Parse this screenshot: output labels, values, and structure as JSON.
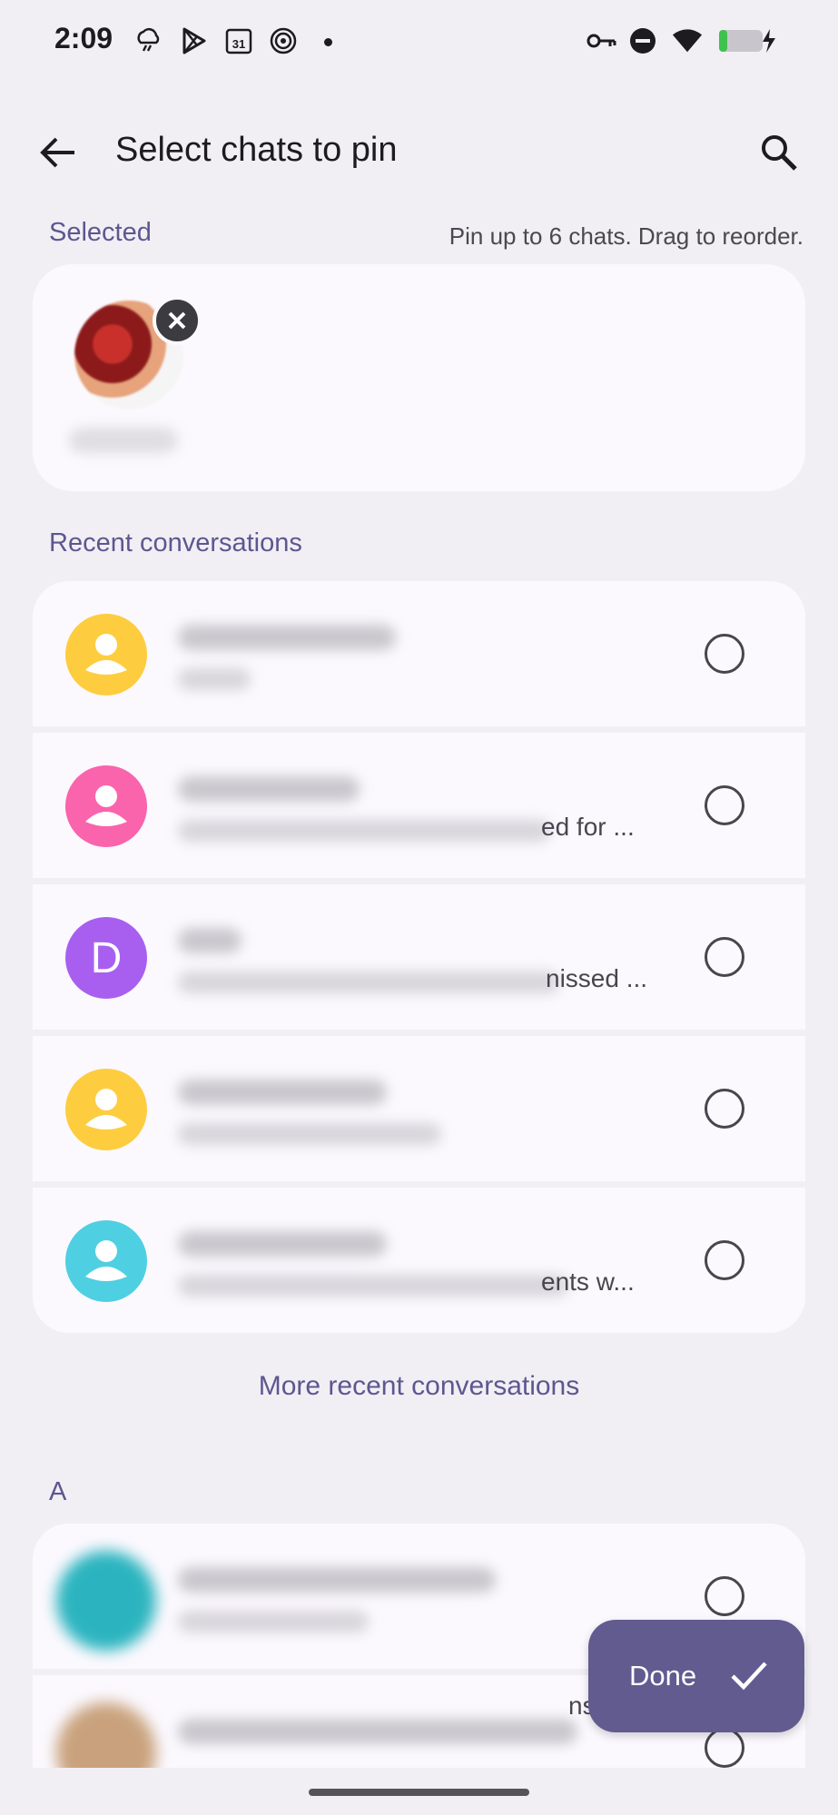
{
  "status_bar": {
    "time": "2:09",
    "left_icons": [
      "weather-icon",
      "play-store-icon",
      "calendar-icon",
      "spiral-icon"
    ],
    "calendar_day": "31",
    "right_icons": [
      "vpn-key-icon",
      "do-not-disturb-icon",
      "wifi-icon",
      "battery-icon"
    ]
  },
  "header": {
    "title": "Select chats to pin"
  },
  "selected_section": {
    "label": "Selected",
    "hint": "Pin up to 6 chats. Drag to reorder."
  },
  "recent_section": {
    "label": "Recent conversations",
    "items": [
      {
        "avatar_type": "person",
        "avatar_color": "#fdcd3f",
        "snippet": ""
      },
      {
        "avatar_type": "person",
        "avatar_color": "#f964ad",
        "snippet": "ed for ..."
      },
      {
        "avatar_type": "letter",
        "avatar_letter": "D",
        "avatar_color": "#a85ff0",
        "snippet": "nissed ..."
      },
      {
        "avatar_type": "person",
        "avatar_color": "#fdcd3f",
        "snippet": ""
      },
      {
        "avatar_type": "person",
        "avatar_color": "#4fcfe2",
        "snippet": "ents w..."
      }
    ],
    "more_label": "More recent conversations"
  },
  "alpha_section": {
    "label": "A",
    "items": [
      {
        "avatar_color": "#2bb4bf",
        "snippet": ""
      },
      {
        "avatar_color": "#c9a27d",
        "snippet": "ns ..."
      }
    ]
  },
  "fab": {
    "label": "Done"
  },
  "colors": {
    "background": "#f1eff4",
    "card": "#fbf9fe",
    "accent": "#625b8f",
    "section_label": "#5d5790"
  }
}
